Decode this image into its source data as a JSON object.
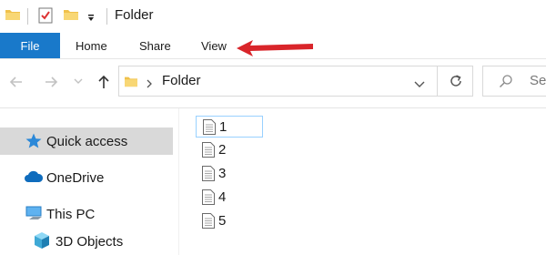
{
  "window": {
    "title": "Folder"
  },
  "quick_access_toolbar": {
    "icons": [
      "folder-icon",
      "properties-icon",
      "new-folder-icon",
      "customize-dropdown-icon"
    ]
  },
  "ribbon": {
    "file_label": "File",
    "tabs": [
      "Home",
      "Share",
      "View"
    ]
  },
  "address_bar": {
    "path_label": "Folder",
    "search_placeholder": "Search Folder",
    "search_visible": "Sea"
  },
  "navigation_pane": {
    "items": [
      {
        "label": "Quick access",
        "icon": "star-icon",
        "selected": true
      },
      {
        "label": "OneDrive",
        "icon": "cloud-icon",
        "selected": false
      },
      {
        "label": "This PC",
        "icon": "computer-icon",
        "selected": false
      },
      {
        "label": "3D Objects",
        "icon": "cube-icon",
        "selected": false
      }
    ]
  },
  "files": [
    {
      "name": "1",
      "focused": true
    },
    {
      "name": "2",
      "focused": false
    },
    {
      "name": "3",
      "focused": false
    },
    {
      "name": "4",
      "focused": false
    },
    {
      "name": "5",
      "focused": false
    }
  ],
  "colors": {
    "file_tab": "#1979ca",
    "annotation_arrow": "#d9252a",
    "selection": "#d9d9d9",
    "focus_border": "#99d1ff"
  }
}
